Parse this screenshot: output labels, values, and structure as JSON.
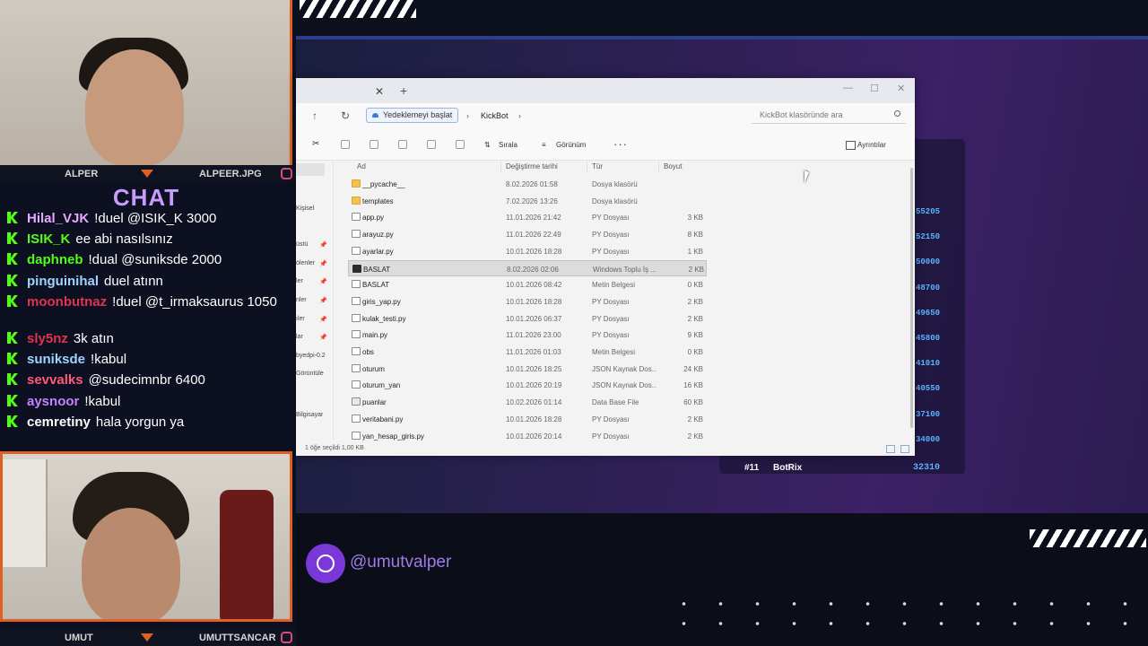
{
  "overlay": {
    "cam_top": {
      "left_name": "ALPER",
      "right_name": "ALPEER.JPG"
    },
    "cam_bottom": {
      "left_name": "UMUT",
      "right_name": "UMUTTSANCAR"
    },
    "chat_title": "CHAT",
    "social_handle": "@umutvalper",
    "accent_color": "#e06024",
    "kick_green": "#53fc18"
  },
  "chat": [
    {
      "user": "Hilal_VJK",
      "color": "#e7a8ff",
      "text": "!duel @ISIK_K 3000"
    },
    {
      "user": "ISIK_K",
      "color": "#53fc18",
      "text": "ee abi nasılsınız"
    },
    {
      "user": "daphneb",
      "color": "#53fc18",
      "text": "!dual @suniksde 2000"
    },
    {
      "user": "pinguinihal",
      "color": "#9ed4ff",
      "text": "duel atınn"
    },
    {
      "user": "moonbutnaz",
      "color": "#e0344f",
      "text": "!duel @t_irmaksaurus 1050"
    },
    {
      "user": "sly5nz",
      "color": "#e0344f",
      "text": "3k atın"
    },
    {
      "user": "suniksde",
      "color": "#9ed4ff",
      "text": "!kabul"
    },
    {
      "user": "sevvalks",
      "color": "#ff5a78",
      "text": "@sudecimnbr 6400"
    },
    {
      "user": "aysnoor",
      "color": "#c680ff",
      "text": "!kabul"
    },
    {
      "user": "cemretiny",
      "color": "#ffffff",
      "text": "hala yorgun ya"
    }
  ],
  "explorer": {
    "backup_button": "Yedeklemeyi başlat",
    "breadcrumb": "KickBot",
    "search_placeholder": "KickBot klasöründe ara",
    "toolbar": {
      "sort": "Sırala",
      "view": "Görünüm",
      "more": "···",
      "details": "Ayrıntılar"
    },
    "sidebar": [
      "Kişisel",
      "üstü",
      "ölenler",
      "ler",
      "nler",
      "ıler",
      "lar",
      "byedpi-0.2",
      "Görüntüle",
      "Bilgisayar"
    ],
    "columns": {
      "name": "Ad",
      "date": "Değiştirme tarihi",
      "type": "Tür",
      "size": "Boyut"
    },
    "files": [
      {
        "name": "__pycache__",
        "date": "8.02.2026 01:58",
        "type": "Dosya klasörü",
        "size": "",
        "icon": "folder"
      },
      {
        "name": "templates",
        "date": "7.02.2026 13:26",
        "type": "Dosya klasörü",
        "size": "",
        "icon": "folder"
      },
      {
        "name": "app.py",
        "date": "11.01.2026 21:42",
        "type": "PY Dosyası",
        "size": "3 KB",
        "icon": "file"
      },
      {
        "name": "arayuz.py",
        "date": "11.01.2026 22:49",
        "type": "PY Dosyası",
        "size": "8 KB",
        "icon": "file"
      },
      {
        "name": "ayarlar.py",
        "date": "10.01.2026 18:28",
        "type": "PY Dosyası",
        "size": "1 KB",
        "icon": "file"
      },
      {
        "name": "BASLAT",
        "date": "8.02.2026 02:06",
        "type": "Windows Toplu İş ...",
        "size": "2 KB",
        "icon": "bat",
        "selected": true
      },
      {
        "name": "BASLAT",
        "date": "10.01.2026 08:42",
        "type": "Metin Belgesi",
        "size": "0 KB",
        "icon": "file"
      },
      {
        "name": "giris_yap.py",
        "date": "10.01.2026 18:28",
        "type": "PY Dosyası",
        "size": "2 KB",
        "icon": "file"
      },
      {
        "name": "kulak_testi.py",
        "date": "10.01.2026 06:37",
        "type": "PY Dosyası",
        "size": "2 KB",
        "icon": "file"
      },
      {
        "name": "main.py",
        "date": "11.01.2026 23:00",
        "type": "PY Dosyası",
        "size": "9 KB",
        "icon": "file"
      },
      {
        "name": "obs",
        "date": "11.01.2026 01:03",
        "type": "Metin Belgesi",
        "size": "0 KB",
        "icon": "file"
      },
      {
        "name": "oturum",
        "date": "10.01.2026 18:25",
        "type": "JSON Kaynak Dos...",
        "size": "24 KB",
        "icon": "file"
      },
      {
        "name": "oturum_yan",
        "date": "10.01.2026 20:19",
        "type": "JSON Kaynak Dos...",
        "size": "16 KB",
        "icon": "file"
      },
      {
        "name": "puanlar",
        "date": "10.02.2026 01:14",
        "type": "Data Base File",
        "size": "60 KB",
        "icon": "db"
      },
      {
        "name": "veritabani.py",
        "date": "10.01.2026 18:28",
        "type": "PY Dosyası",
        "size": "2 KB",
        "icon": "file"
      },
      {
        "name": "yan_hesap_giris.py",
        "date": "10.01.2026 20:14",
        "type": "PY Dosyası",
        "size": "2 KB",
        "icon": "file"
      }
    ],
    "status": "1 öğe seçildi  1,00 KB"
  },
  "leaderboard": {
    "visible_scores": [
      "55205",
      "52150",
      "50000",
      "48700",
      "49650",
      "45800",
      "41010",
      "40550",
      "37100",
      "34000"
    ],
    "last_row": {
      "rank": "#11",
      "name": "BotRix",
      "points": "32310"
    }
  }
}
